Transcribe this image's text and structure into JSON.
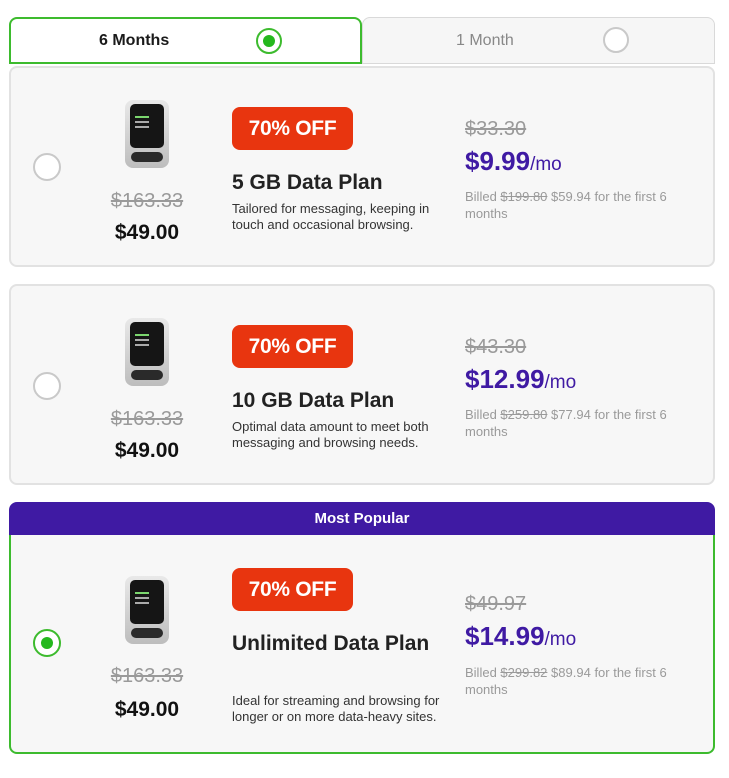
{
  "tabs": [
    {
      "label": "6 Months",
      "selected": true
    },
    {
      "label": "1 Month",
      "selected": false
    }
  ],
  "popular_label": "Most Popular",
  "plans": [
    {
      "selected": false,
      "device_old_price": "$163.33",
      "device_price": "$49.00",
      "badge": "70% OFF",
      "name": "5 GB Data Plan",
      "description": "Tailored for messaging, keeping in touch and occasional browsing.",
      "old_monthly": "$33.30",
      "monthly": "$9.99",
      "unit": "/mo",
      "billed_prefix": "Billed",
      "billed_old": "$199.80",
      "billed_new": "$59.94",
      "billed_suffix": "for the first 6 months"
    },
    {
      "selected": false,
      "device_old_price": "$163.33",
      "device_price": "$49.00",
      "badge": "70% OFF",
      "name": "10 GB Data Plan",
      "description": "Optimal data amount to meet both messaging and browsing needs.",
      "old_monthly": "$43.30",
      "monthly": "$12.99",
      "unit": "/mo",
      "billed_prefix": "Billed",
      "billed_old": "$259.80",
      "billed_new": "$77.94",
      "billed_suffix": "for the first 6 months"
    },
    {
      "selected": true,
      "device_old_price": "$163.33",
      "device_price": "$49.00",
      "badge": "70% OFF",
      "name": "Unlimited Data Plan",
      "description": "Ideal for streaming and browsing for longer or on more data-heavy sites.",
      "old_monthly": "$49.97",
      "monthly": "$14.99",
      "unit": "/mo",
      "billed_prefix": "Billed",
      "billed_old": "$299.82",
      "billed_new": "$89.94",
      "billed_suffix": "for the first 6 months"
    }
  ],
  "colors": {
    "accent_green": "#3dbb2e",
    "badge_red": "#e8350f",
    "price_purple": "#3f1aa3"
  }
}
